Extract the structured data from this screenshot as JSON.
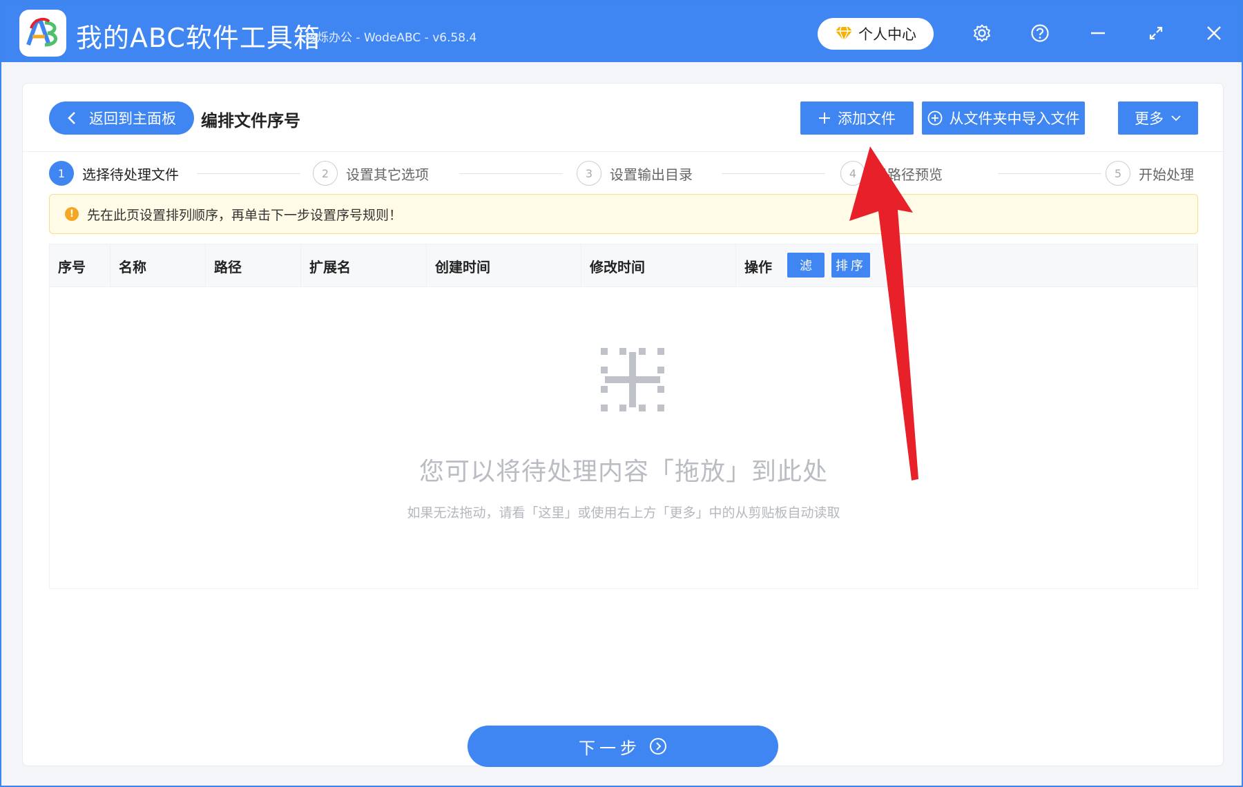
{
  "app": {
    "title": "我的ABC软件工具箱",
    "subtitle": "核烁办公 - WodeABC - v6.58.4",
    "logo_text": "AB"
  },
  "titlebar": {
    "user_center_label": "个人中心",
    "icons": [
      "diamond-icon",
      "gear-icon",
      "help-icon",
      "minimize-icon",
      "maximize-icon",
      "close-icon"
    ]
  },
  "toolbar": {
    "back_label": "返回到主面板",
    "page_title": "编排文件序号",
    "add_file_label": "添加文件",
    "import_folder_label": "从文件夹中导入文件",
    "more_label": "更多"
  },
  "steps": [
    {
      "num": "1",
      "label": "选择待处理文件",
      "active": true
    },
    {
      "num": "2",
      "label": "设置其它选项",
      "active": false
    },
    {
      "num": "3",
      "label": "设置输出目录",
      "active": false
    },
    {
      "num": "4",
      "label": "果路径预览",
      "active": false
    },
    {
      "num": "5",
      "label": "开始处理",
      "active": false
    }
  ],
  "notice": {
    "text": "先在此页设置排列顺序，再单击下一步设置序号规则！"
  },
  "table": {
    "columns": [
      "序号",
      "名称",
      "路径",
      "扩展名",
      "创建时间",
      "修改时间",
      "操作"
    ],
    "filter_label": "过滤",
    "filter_visible_text": "滤",
    "sort_label": "排序"
  },
  "empty": {
    "title": "您可以将待处理内容「拖放」到此处",
    "hint": "如果无法拖动，请看「这里」或使用右上方「更多」中的从剪贴板自动读取"
  },
  "footer": {
    "next_label": "下一步"
  },
  "colors": {
    "brand": "#3f86f2",
    "notice_bg": "#fffbe6",
    "arrow": "#e8202a"
  }
}
